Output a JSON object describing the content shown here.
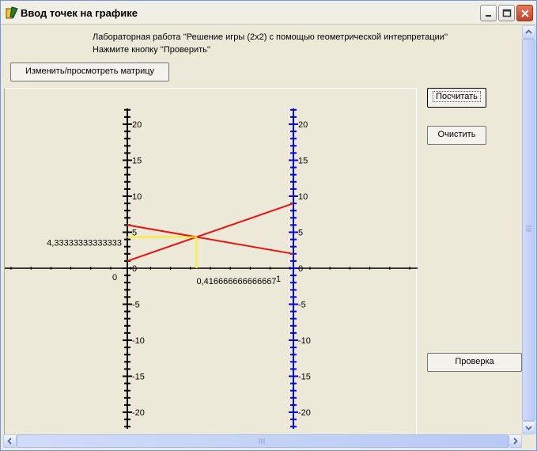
{
  "window": {
    "title": "Ввод точек на графике",
    "minimize_glyph": "_",
    "maximize_glyph": "□",
    "close_glyph": "×"
  },
  "info": {
    "line1": "Лабораторная работа ''Решение игры (2х2) с помощью геометрической интерпретации''",
    "line2": "Нажмите кнопку ''Проверить''"
  },
  "buttons": {
    "matrix": "Изменить/просмотреть матрицу",
    "calculate": "Посчитать",
    "clear": "Очистить",
    "check": "Проверка"
  },
  "chart_data": {
    "type": "line",
    "title": "",
    "xlabel": "",
    "ylabel": "",
    "xlim": [
      0,
      1
    ],
    "ylim": [
      -20,
      20
    ],
    "left_axis_ticks": [
      "20",
      "15",
      "10",
      "5",
      "0",
      "-5",
      "-10",
      "-15",
      "-20"
    ],
    "right_axis_ticks": [
      "20",
      "15",
      "10",
      "5",
      "0",
      "-5",
      "-10",
      "-15",
      "-20"
    ],
    "x_tick_labels": [
      "0",
      "1"
    ],
    "series": [
      {
        "x": [
          0,
          1
        ],
        "y": [
          1,
          9
        ],
        "color": "#ee1111"
      },
      {
        "x": [
          0,
          1
        ],
        "y": [
          6,
          2
        ],
        "color": "#ee1111"
      }
    ],
    "solution": {
      "x": 0.416666666666667,
      "y": 4.33333333333333,
      "x_label": "0,416666666666667",
      "y_label": "4,33333333333333",
      "color": "#ffee22"
    },
    "left_axis_color": "#000000",
    "right_axis_color": "#0000ee",
    "horizontal_axis_color": "#000000"
  }
}
